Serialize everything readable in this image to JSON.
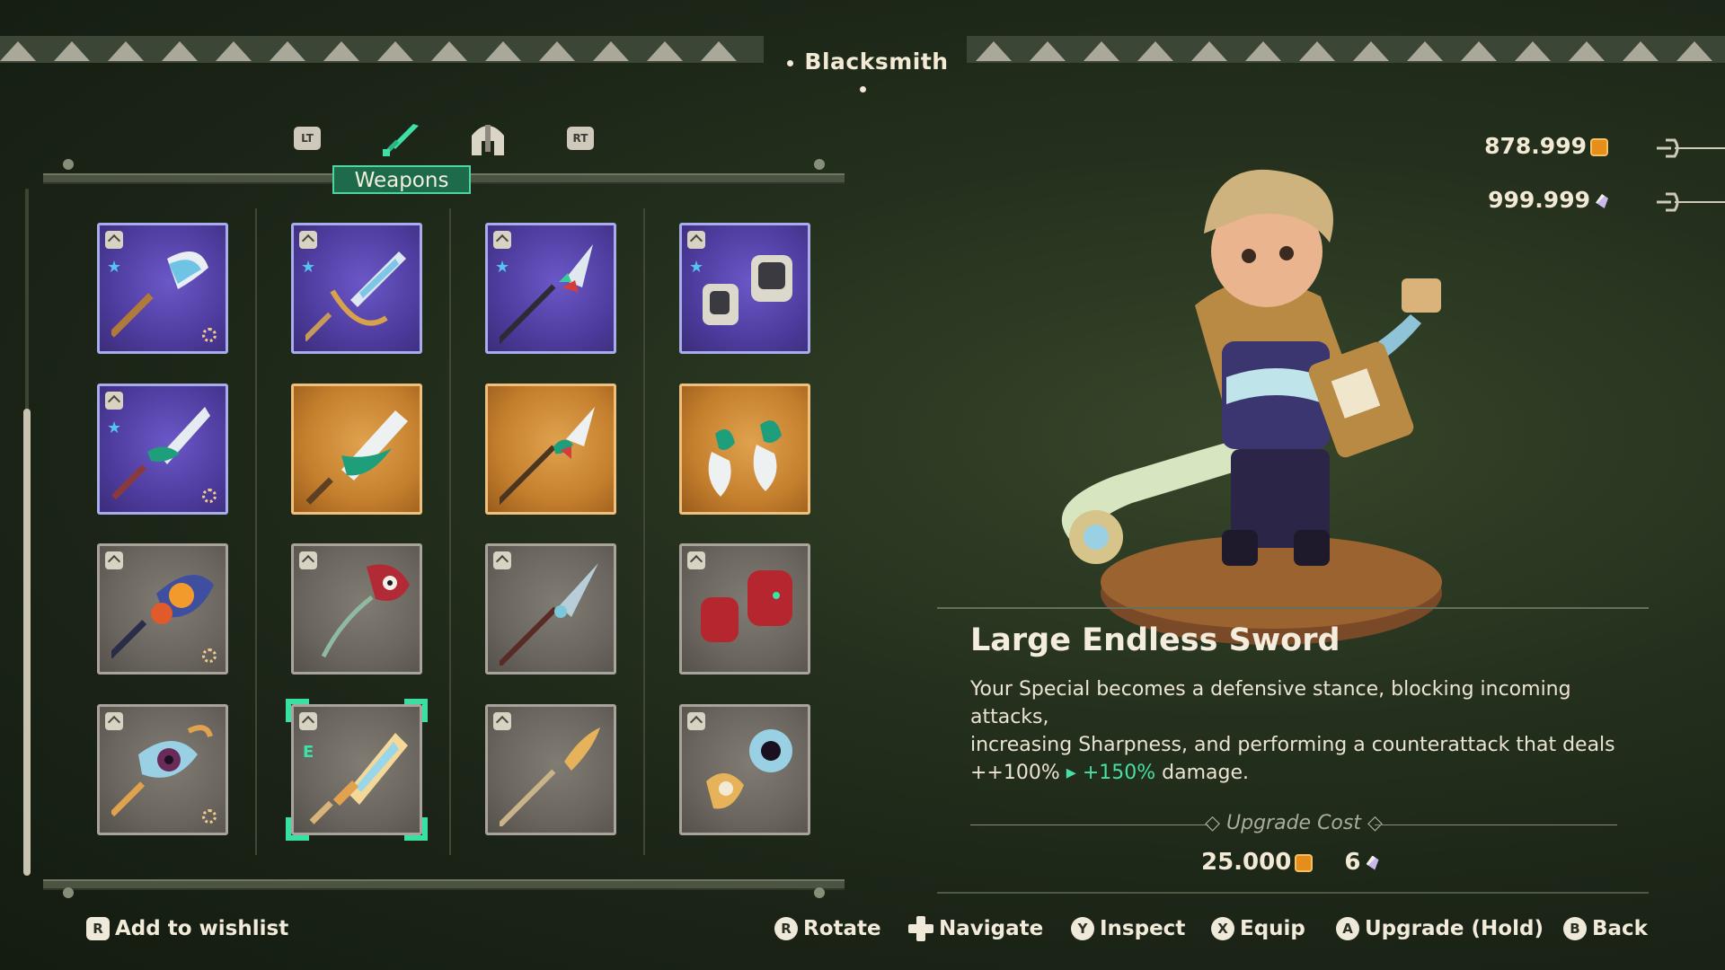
{
  "header": {
    "title": "Blacksmith"
  },
  "tabs": {
    "left_trigger": "LT",
    "right_trigger": "RT",
    "active_label": "Weapons",
    "items": [
      {
        "icon": "sword-icon",
        "active": true
      },
      {
        "icon": "helmet-icon",
        "active": false
      }
    ]
  },
  "currencies": [
    {
      "value": "878.999",
      "icon": "coin-icon"
    },
    {
      "value": "999.999",
      "icon": "gem-icon"
    }
  ],
  "grid": {
    "rows": [
      [
        {
          "rarity": "purple",
          "star": true,
          "ring": true,
          "icon": "axe-sword-icon"
        },
        {
          "rarity": "purple",
          "star": true,
          "ring": false,
          "icon": "crossbow-blade-icon"
        },
        {
          "rarity": "purple",
          "star": true,
          "ring": false,
          "icon": "spear-icon"
        },
        {
          "rarity": "purple",
          "star": true,
          "ring": false,
          "icon": "gauntlets-icon"
        }
      ],
      [
        {
          "rarity": "purple",
          "star": true,
          "ring": true,
          "icon": "vine-sword-icon"
        },
        {
          "rarity": "gold",
          "star": false,
          "ring": false,
          "icon": "vine-greatsword-icon"
        },
        {
          "rarity": "gold",
          "star": false,
          "ring": false,
          "icon": "vine-spear-icon"
        },
        {
          "rarity": "gold",
          "star": false,
          "ring": false,
          "icon": "vine-axes-icon"
        }
      ],
      [
        {
          "rarity": "gray",
          "star": false,
          "ring": true,
          "icon": "flame-staff-icon"
        },
        {
          "rarity": "gray",
          "star": false,
          "ring": false,
          "icon": "red-hammer-icon"
        },
        {
          "rarity": "gray",
          "star": false,
          "ring": false,
          "icon": "long-spear-icon"
        },
        {
          "rarity": "gray",
          "star": false,
          "ring": false,
          "icon": "red-gauntlets-icon"
        }
      ],
      [
        {
          "rarity": "gray",
          "star": false,
          "ring": true,
          "icon": "eye-staff-icon"
        },
        {
          "rarity": "gray",
          "star": false,
          "ring": false,
          "icon": "endless-sword-icon",
          "selected": true,
          "equipped_mark": "E"
        },
        {
          "rarity": "gray",
          "star": false,
          "ring": false,
          "icon": "golden-spear-icon"
        },
        {
          "rarity": "gray",
          "star": false,
          "ring": false,
          "icon": "eye-gauntlets-icon"
        }
      ]
    ]
  },
  "detail": {
    "name": "Large Endless Sword",
    "desc_line1": "Your Special becomes a defensive stance, blocking incoming attacks,",
    "desc_line2": "increasing Sharpness, and performing a counterattack that deals",
    "desc_current": "++100%",
    "desc_arrow": "▸",
    "desc_next": "+150%",
    "desc_end": "damage.",
    "upgrade_cost_label": "Upgrade Cost",
    "cost_coins": "25.000",
    "cost_gems": "6"
  },
  "footer": {
    "wishlist_button": "R",
    "wishlist": "Add to wishlist",
    "rotate_button": "R",
    "rotate": "Rotate",
    "navigate": "Navigate",
    "inspect_button": "Y",
    "inspect": "Inspect",
    "equip_button": "X",
    "equip": "Equip",
    "upgrade_button": "A",
    "upgrade": "Upgrade (Hold)",
    "back_button": "B",
    "back": "Back"
  },
  "colors": {
    "accent": "#39e0a4",
    "rare": "#5a48b4",
    "epic": "#d28f3a",
    "common": "#6a655e"
  }
}
